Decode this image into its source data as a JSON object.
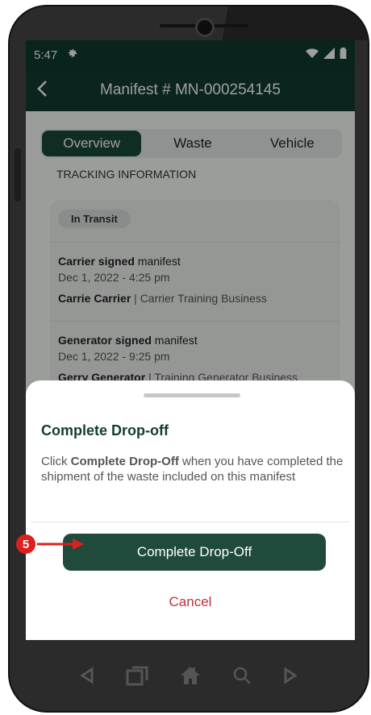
{
  "status": {
    "time": "5:47"
  },
  "header": {
    "title": "Manifest # MN-000254145"
  },
  "tabs": [
    {
      "label": "Overview",
      "active": true
    },
    {
      "label": "Waste",
      "active": false
    },
    {
      "label": "Vehicle",
      "active": false
    }
  ],
  "tracking": {
    "section_label": "TRACKING INFORMATION",
    "status_badge": "In Transit",
    "entries": [
      {
        "actor": "Carrier signed",
        "action": " manifest",
        "date": "Dec 1, 2022 - 4:25 pm",
        "name": "Carrie Carrier",
        "org": " | Carrier Training Business"
      },
      {
        "actor": "Generator signed",
        "action": " manifest",
        "date": "Dec 1, 2022 - 9:25 pm",
        "name": "Gerry Generator",
        "org": " | Training Generator Business"
      }
    ]
  },
  "sheet": {
    "title": "Complete Drop-off",
    "desc_prefix": "Click ",
    "desc_bold": "Complete Drop-Off",
    "desc_suffix": " when you have completed the shipment of the waste included on this manifest",
    "primary_label": "Complete Drop-Off",
    "cancel_label": "Cancel"
  },
  "callout": {
    "number": "5"
  },
  "colors": {
    "primary": "#1f4a3c",
    "cancel": "#c0303b",
    "callout": "#e01e1e"
  },
  "icons": [
    "settings-icon",
    "wifi-icon",
    "signal-icon",
    "battery-icon",
    "back-arrow-icon",
    "nav-back-icon",
    "nav-recents-icon",
    "nav-home-icon",
    "nav-search-icon",
    "nav-forward-icon"
  ]
}
